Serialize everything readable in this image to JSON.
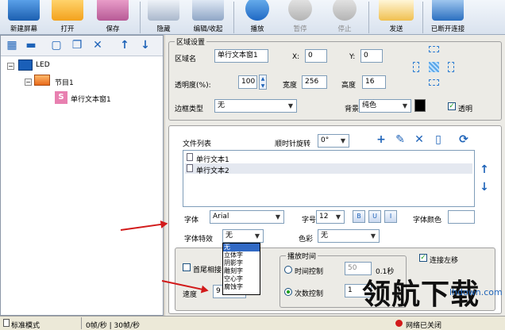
{
  "toolbar": {
    "new_screen": "新建屏幕",
    "open": "打开",
    "save": "保存",
    "hide": "隐藏",
    "edit_collapse": "编辑/收起",
    "play": "播放",
    "pause": "暂停",
    "stop": "停止",
    "send": "发送",
    "disconnect": "已断开连接"
  },
  "tree": {
    "root": "LED",
    "program": "节目1",
    "window": "单行文本窗1"
  },
  "area": {
    "title": "区域设置",
    "name_label": "区域名",
    "name_value": "单行文本窗1",
    "x_label": "X:",
    "x_value": "0",
    "y_label": "Y:",
    "y_value": "0",
    "opacity_label": "透明度(%):",
    "opacity_value": "100",
    "width_label": "宽度",
    "width_value": "256",
    "height_label": "高度",
    "height_value": "16",
    "border_label": "边框类型",
    "border_value": "无",
    "bg_label": "背景",
    "bg_value": "纯色",
    "transparent_label": "透明"
  },
  "files": {
    "label": "文件列表",
    "rotate_label": "顺时针旋转",
    "rotate_value": "0°",
    "items": [
      "单行文本1",
      "单行文本2"
    ]
  },
  "font": {
    "font_label": "字体",
    "font_value": "Arial",
    "size_label": "字号",
    "size_value": "12",
    "b": "B",
    "u": "U",
    "i": "I",
    "color_label": "字体颜色",
    "effect_label": "字体特效",
    "effect_value": "无",
    "effect_options": [
      "无",
      "立体字",
      "阴影字",
      "雕刻字",
      "空心字",
      "腐蚀字"
    ],
    "color2_label": "色彩",
    "color2_value": "无"
  },
  "play": {
    "tail_label": "首尾相接",
    "speed_label": "速度",
    "speed_value": "9",
    "time_title": "播放时间",
    "time_ctrl_label": "时间控制",
    "time_value": "50",
    "time_unit": "0.1秒",
    "count_ctrl_label": "次数控制",
    "count_value": "1",
    "connect_left_label": "连接左移"
  },
  "status": {
    "mode": "标准模式",
    "rate": "0帧/秒 | 30帧/秒",
    "conn": "网络已关闭"
  },
  "watermark": {
    "brand": "领航下载",
    "url": "lhdown.com"
  },
  "colors": {
    "accent": "#1e63b8",
    "arrow": "#d21a1a"
  }
}
